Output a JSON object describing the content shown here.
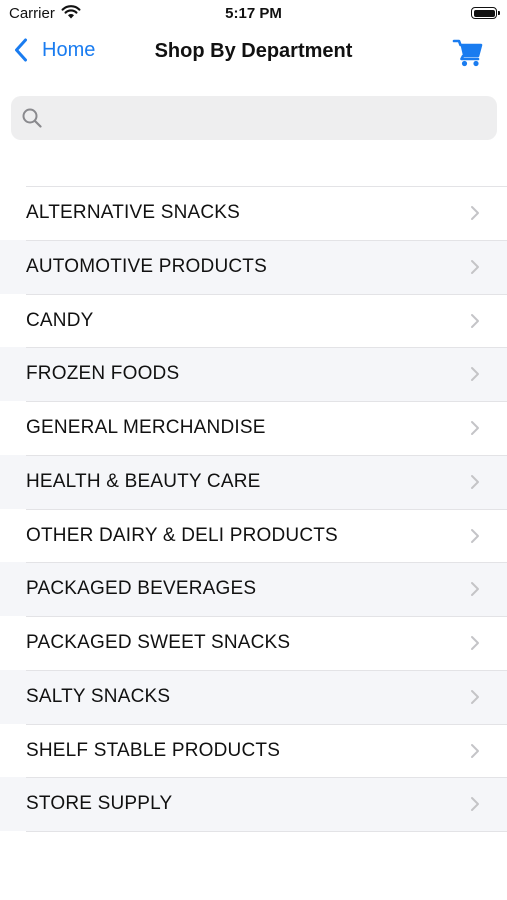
{
  "status_bar": {
    "carrier": "Carrier",
    "time": "5:17 PM",
    "wifi_icon": "wifi-icon",
    "battery_icon": "battery-icon"
  },
  "nav": {
    "back_label": "Home",
    "title": "Shop By Department",
    "cart_icon": "cart-icon",
    "accent_color": "#1a7cf0"
  },
  "search": {
    "placeholder": "",
    "value": ""
  },
  "departments": [
    "ALTERNATIVE SNACKS",
    "AUTOMOTIVE PRODUCTS",
    "CANDY",
    "FROZEN FOODS",
    "GENERAL MERCHANDISE",
    "HEALTH & BEAUTY CARE",
    "OTHER DAIRY & DELI PRODUCTS",
    "PACKAGED BEVERAGES",
    "PACKAGED SWEET SNACKS",
    "SALTY SNACKS",
    "SHELF STABLE PRODUCTS",
    "STORE SUPPLY"
  ]
}
